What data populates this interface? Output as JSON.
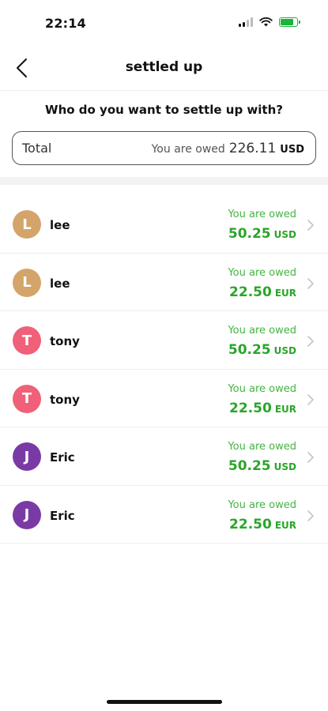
{
  "status": {
    "time": "22:14"
  },
  "nav": {
    "title": "settled up"
  },
  "prompt": "Who do you want to settle up with?",
  "total": {
    "label": "Total",
    "owed_text": "You are owed",
    "amount": "226.11",
    "currency": "USD"
  },
  "rows": [
    {
      "initial": "L",
      "name": "lee",
      "owed_text": "You are owed",
      "amount": "50.25",
      "currency": "USD",
      "color": "#d4a46a"
    },
    {
      "initial": "L",
      "name": "lee",
      "owed_text": "You are owed",
      "amount": "22.50",
      "currency": "EUR",
      "color": "#d4a46a"
    },
    {
      "initial": "T",
      "name": "tony",
      "owed_text": "You are owed",
      "amount": "50.25",
      "currency": "USD",
      "color": "#f06079"
    },
    {
      "initial": "T",
      "name": "tony",
      "owed_text": "You are owed",
      "amount": "22.50",
      "currency": "EUR",
      "color": "#f06079"
    },
    {
      "initial": "J",
      "name": "Eric",
      "owed_text": "You are owed",
      "amount": "50.25",
      "currency": "USD",
      "color": "#7a3aa6"
    },
    {
      "initial": "J",
      "name": "Eric",
      "owed_text": "You are owed",
      "amount": "22.50",
      "currency": "EUR",
      "color": "#7a3aa6"
    }
  ],
  "colors": {
    "owed_green": "#2aa52a"
  }
}
